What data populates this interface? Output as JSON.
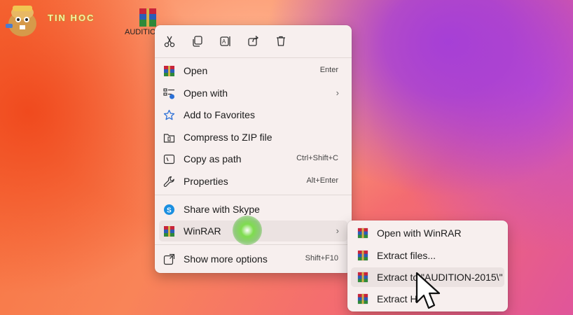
{
  "desktop": {
    "logo_text": "TIN HOC",
    "icon_label": "AUDITIO"
  },
  "toolbar": {
    "icons": [
      "cut-icon",
      "copy-icon",
      "rename-icon",
      "share-icon",
      "delete-icon"
    ]
  },
  "menu": {
    "items": [
      {
        "label": "Open",
        "shortcut": "Enter",
        "icon": "winrar-icon"
      },
      {
        "label": "Open with",
        "icon": "open-with-icon",
        "submenu": true
      },
      {
        "label": "Add to Favorites",
        "icon": "star-icon"
      },
      {
        "label": "Compress to ZIP file",
        "icon": "zip-icon"
      },
      {
        "label": "Copy as path",
        "shortcut": "Ctrl+Shift+C",
        "icon": "copy-path-icon"
      },
      {
        "label": "Properties",
        "shortcut": "Alt+Enter",
        "icon": "wrench-icon"
      },
      {
        "label": "Share with Skype",
        "icon": "skype-icon"
      },
      {
        "label": "WinRAR",
        "icon": "winrar-icon",
        "submenu": true
      },
      {
        "label": "Show more options",
        "shortcut": "Shift+F10",
        "icon": "more-options-icon"
      }
    ],
    "arrow": "›"
  },
  "submenu": {
    "items": [
      {
        "label": "Open with WinRAR"
      },
      {
        "label": "Extract files..."
      },
      {
        "label": "Extract to \"AUDITION-2015\\\""
      },
      {
        "label": "Extract H"
      }
    ]
  },
  "colors": {
    "menu_bg": "#f7efee",
    "hover_bg": "#ece3e2",
    "skype_blue": "#1b8fe0",
    "star_blue": "#2b6fd6",
    "click_glow": "#5fcf3a"
  }
}
